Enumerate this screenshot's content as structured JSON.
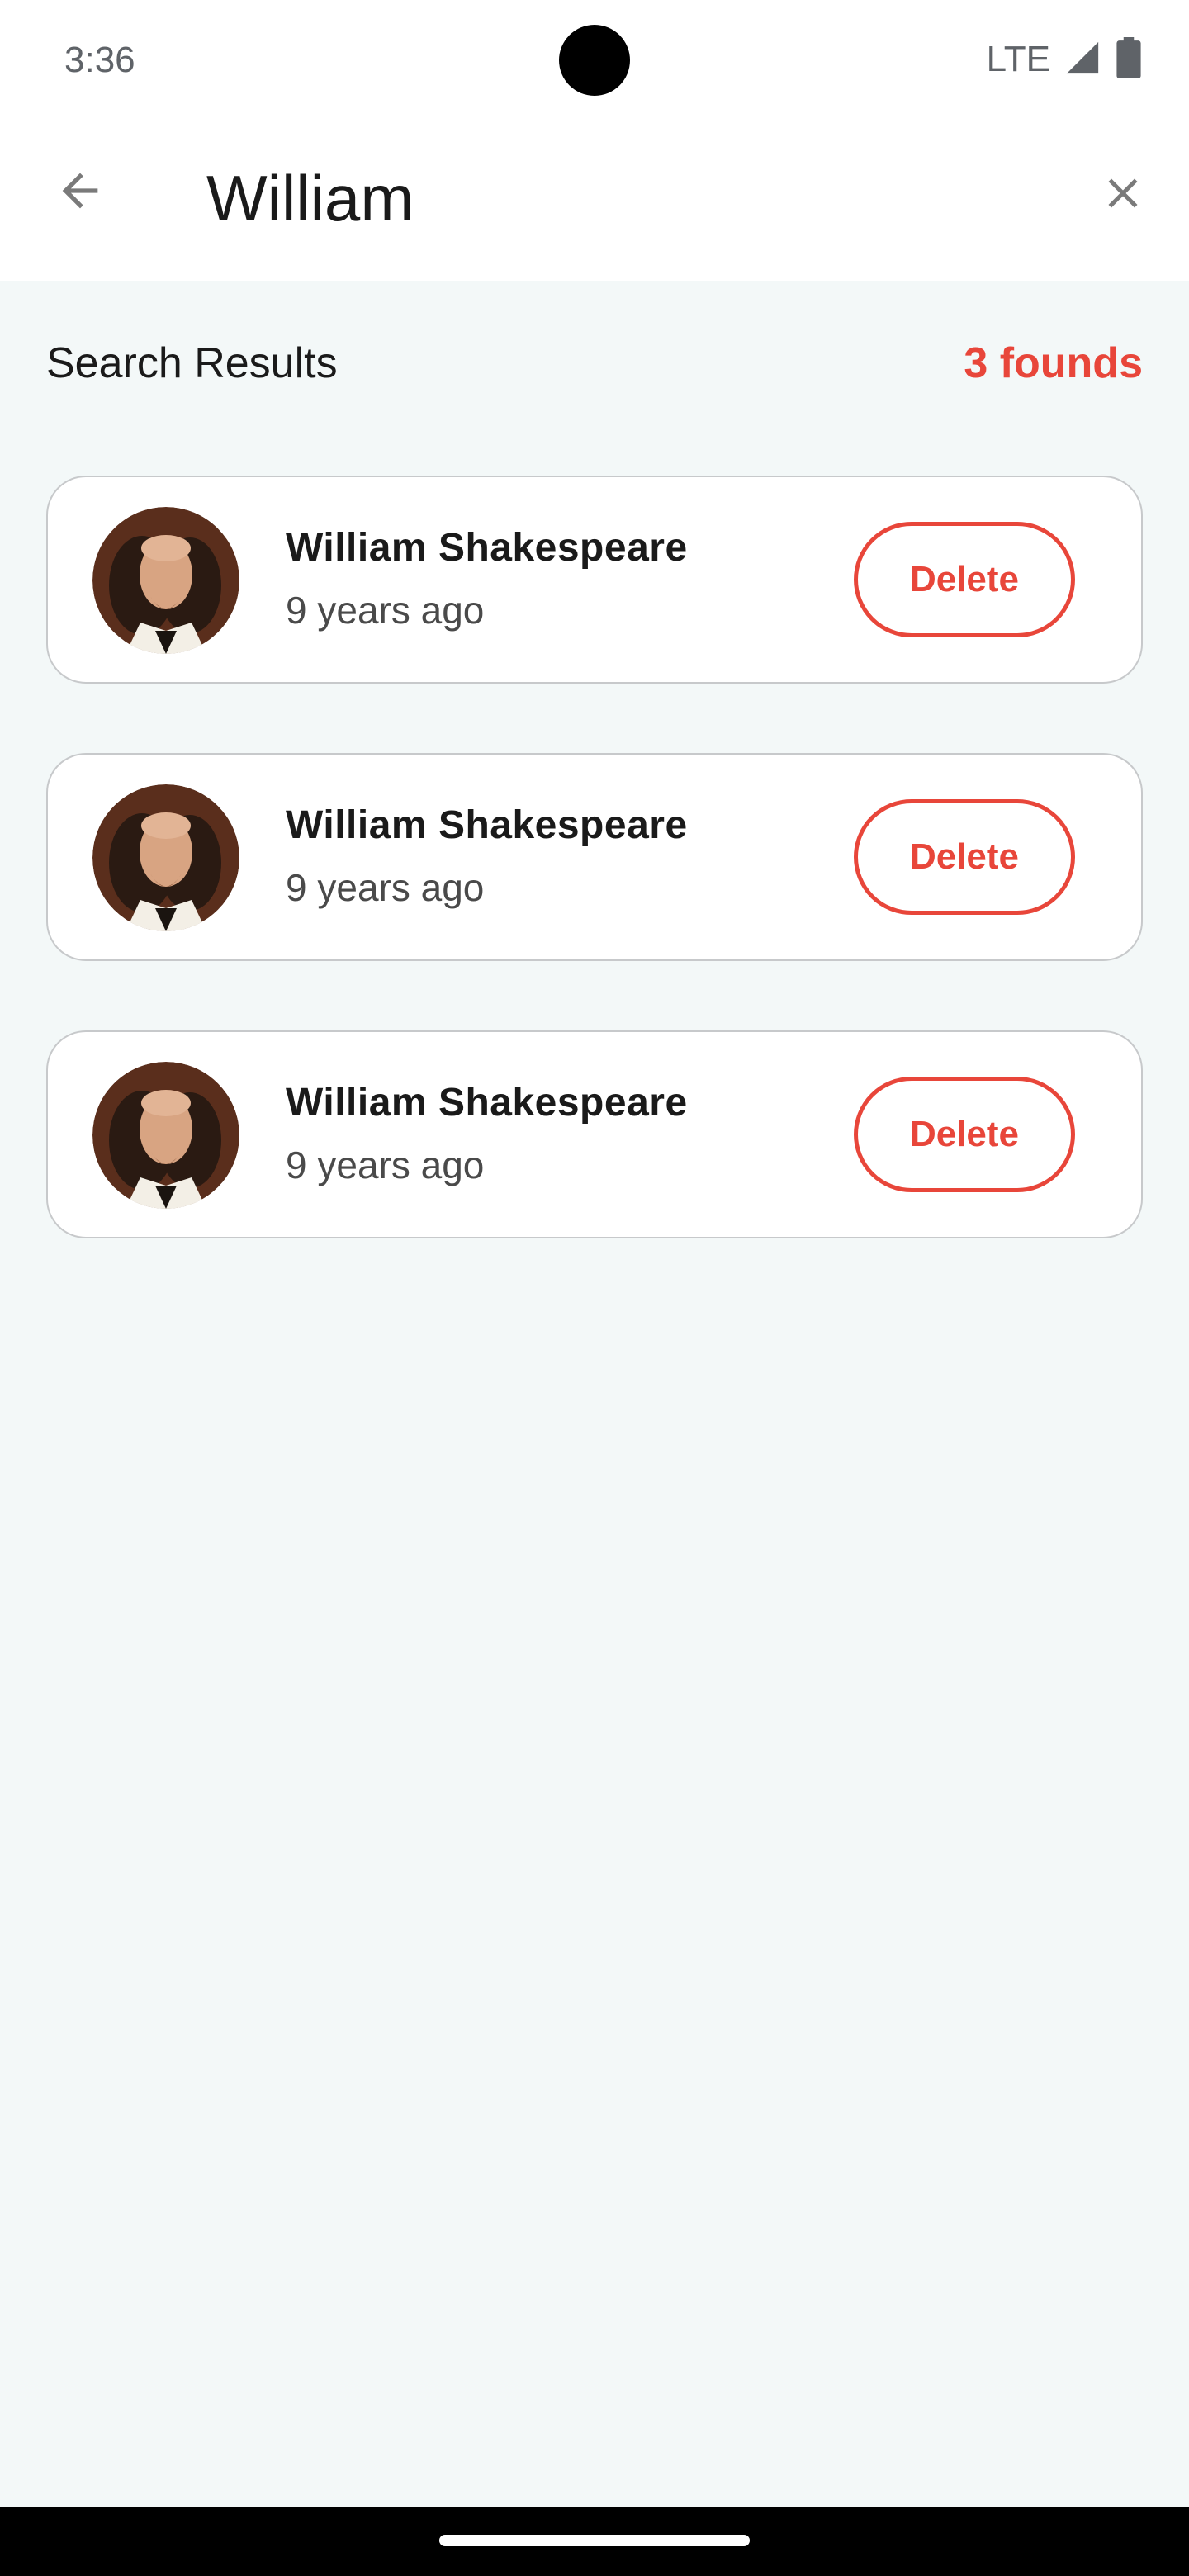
{
  "status_bar": {
    "time": "3:36",
    "network": "LTE",
    "icons": [
      "signal-icon",
      "battery-icon"
    ]
  },
  "search": {
    "value": "William",
    "back_icon": "arrow-back-icon",
    "clear_icon": "close-icon"
  },
  "results": {
    "title": "Search Results",
    "count_label": "3 founds",
    "items": [
      {
        "name": "William Shakespeare",
        "time": "9 years ago",
        "action": "Delete"
      },
      {
        "name": "William Shakespeare",
        "time": "9 years ago",
        "action": "Delete"
      },
      {
        "name": "William Shakespeare",
        "time": "9 years ago",
        "action": "Delete"
      }
    ]
  },
  "colors": {
    "accent": "#e8463a",
    "background": "#f3f8f8",
    "card_border": "#c7c9cb"
  }
}
